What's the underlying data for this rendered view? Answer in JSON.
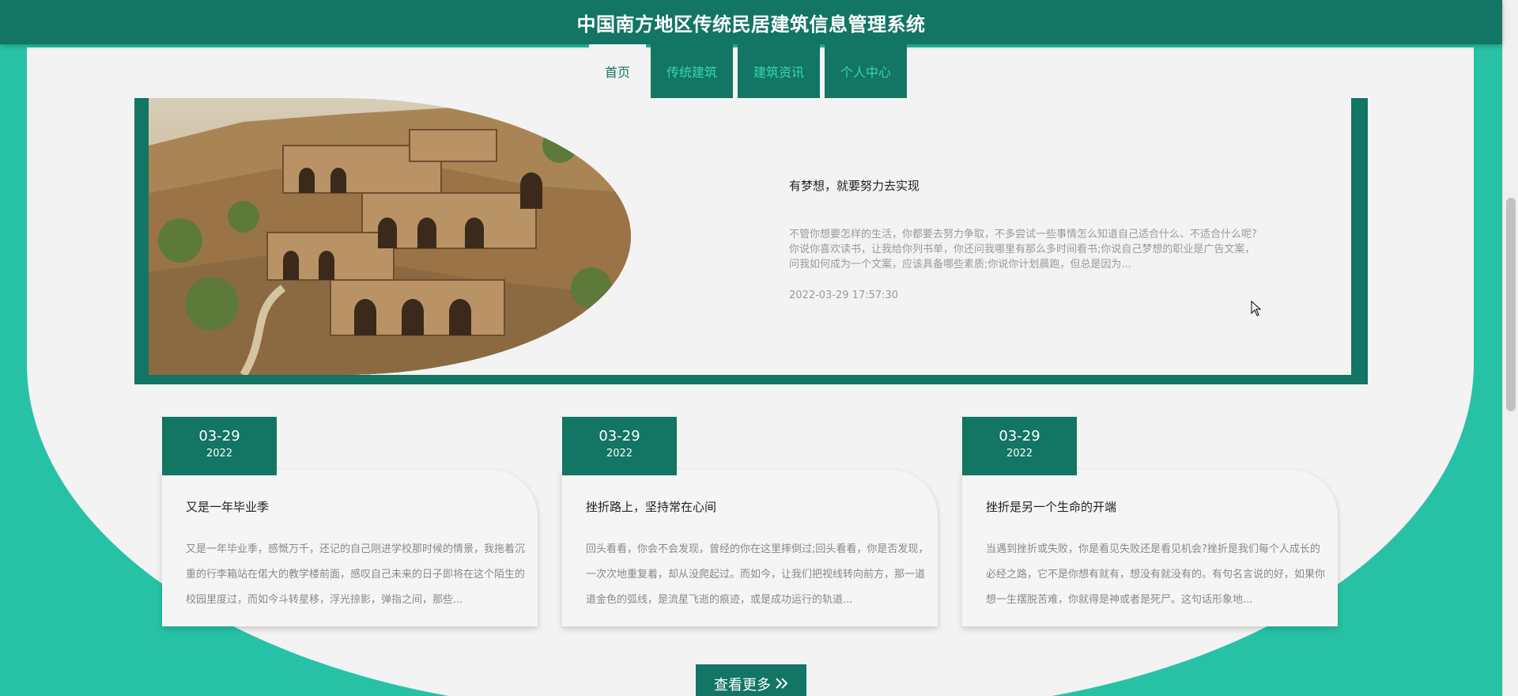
{
  "app": {
    "title": "中国南方地区传统民居建筑信息管理系统"
  },
  "nav": {
    "tabs": [
      {
        "label": "首页",
        "active": true
      },
      {
        "label": "传统建筑",
        "active": false
      },
      {
        "label": "建筑资讯",
        "active": false
      },
      {
        "label": "个人中心",
        "active": false
      }
    ]
  },
  "feature": {
    "title": "有梦想，就要努力去实现",
    "description": "不管你想要怎样的生活，你都要去努力争取，不多尝试一些事情怎么知道自己适合什么、不适合什么呢?你说你喜欢读书，让我给你列书单，你还问我哪里有那么多时间看书;你说自己梦想的职业是广告文案，问我如何成为一个文案，应该具备哪些素质;你说你计划晨跑，但总是因为...",
    "date": "2022-03-29 17:57:30"
  },
  "cards": [
    {
      "month_day": "03-29",
      "year": "2022",
      "title": "又是一年毕业季",
      "description": "又是一年毕业季，感慨万千，还记的自己刚进学校那时候的情景，我拖着沉重的行李箱站在偌大的教学楼前面，感叹自己未来的日子即将在这个陌生的校园里度过，而如今斗转星移，浮光掠影，弹指之间，那些..."
    },
    {
      "month_day": "03-29",
      "year": "2022",
      "title": "挫折路上，坚持常在心间",
      "description": "回头看看，你会不会发现，曾经的你在这里摔倒过;回头看看，你是否发现，一次次地重复着，却从没爬起过。而如今，让我们把视线转向前方，那一道道金色的弧线，是流星飞逝的痕迹，或是成功运行的轨道..."
    },
    {
      "month_day": "03-29",
      "year": "2022",
      "title": "挫折是另一个生命的开端",
      "description": "当遇到挫折或失败，你是看见失败还是看见机会?挫折是我们每个人成长的必经之路，它不是你想有就有，想没有就没有的。有句名言说的好，如果你想一生摆脱苦难，你就得是神或者是死尸。这句话形象地..."
    }
  ],
  "more": {
    "label": "查看更多"
  },
  "colors": {
    "dark_teal": "#137563",
    "teal": "#27c2a6",
    "light_teal": "#35d5b4"
  }
}
